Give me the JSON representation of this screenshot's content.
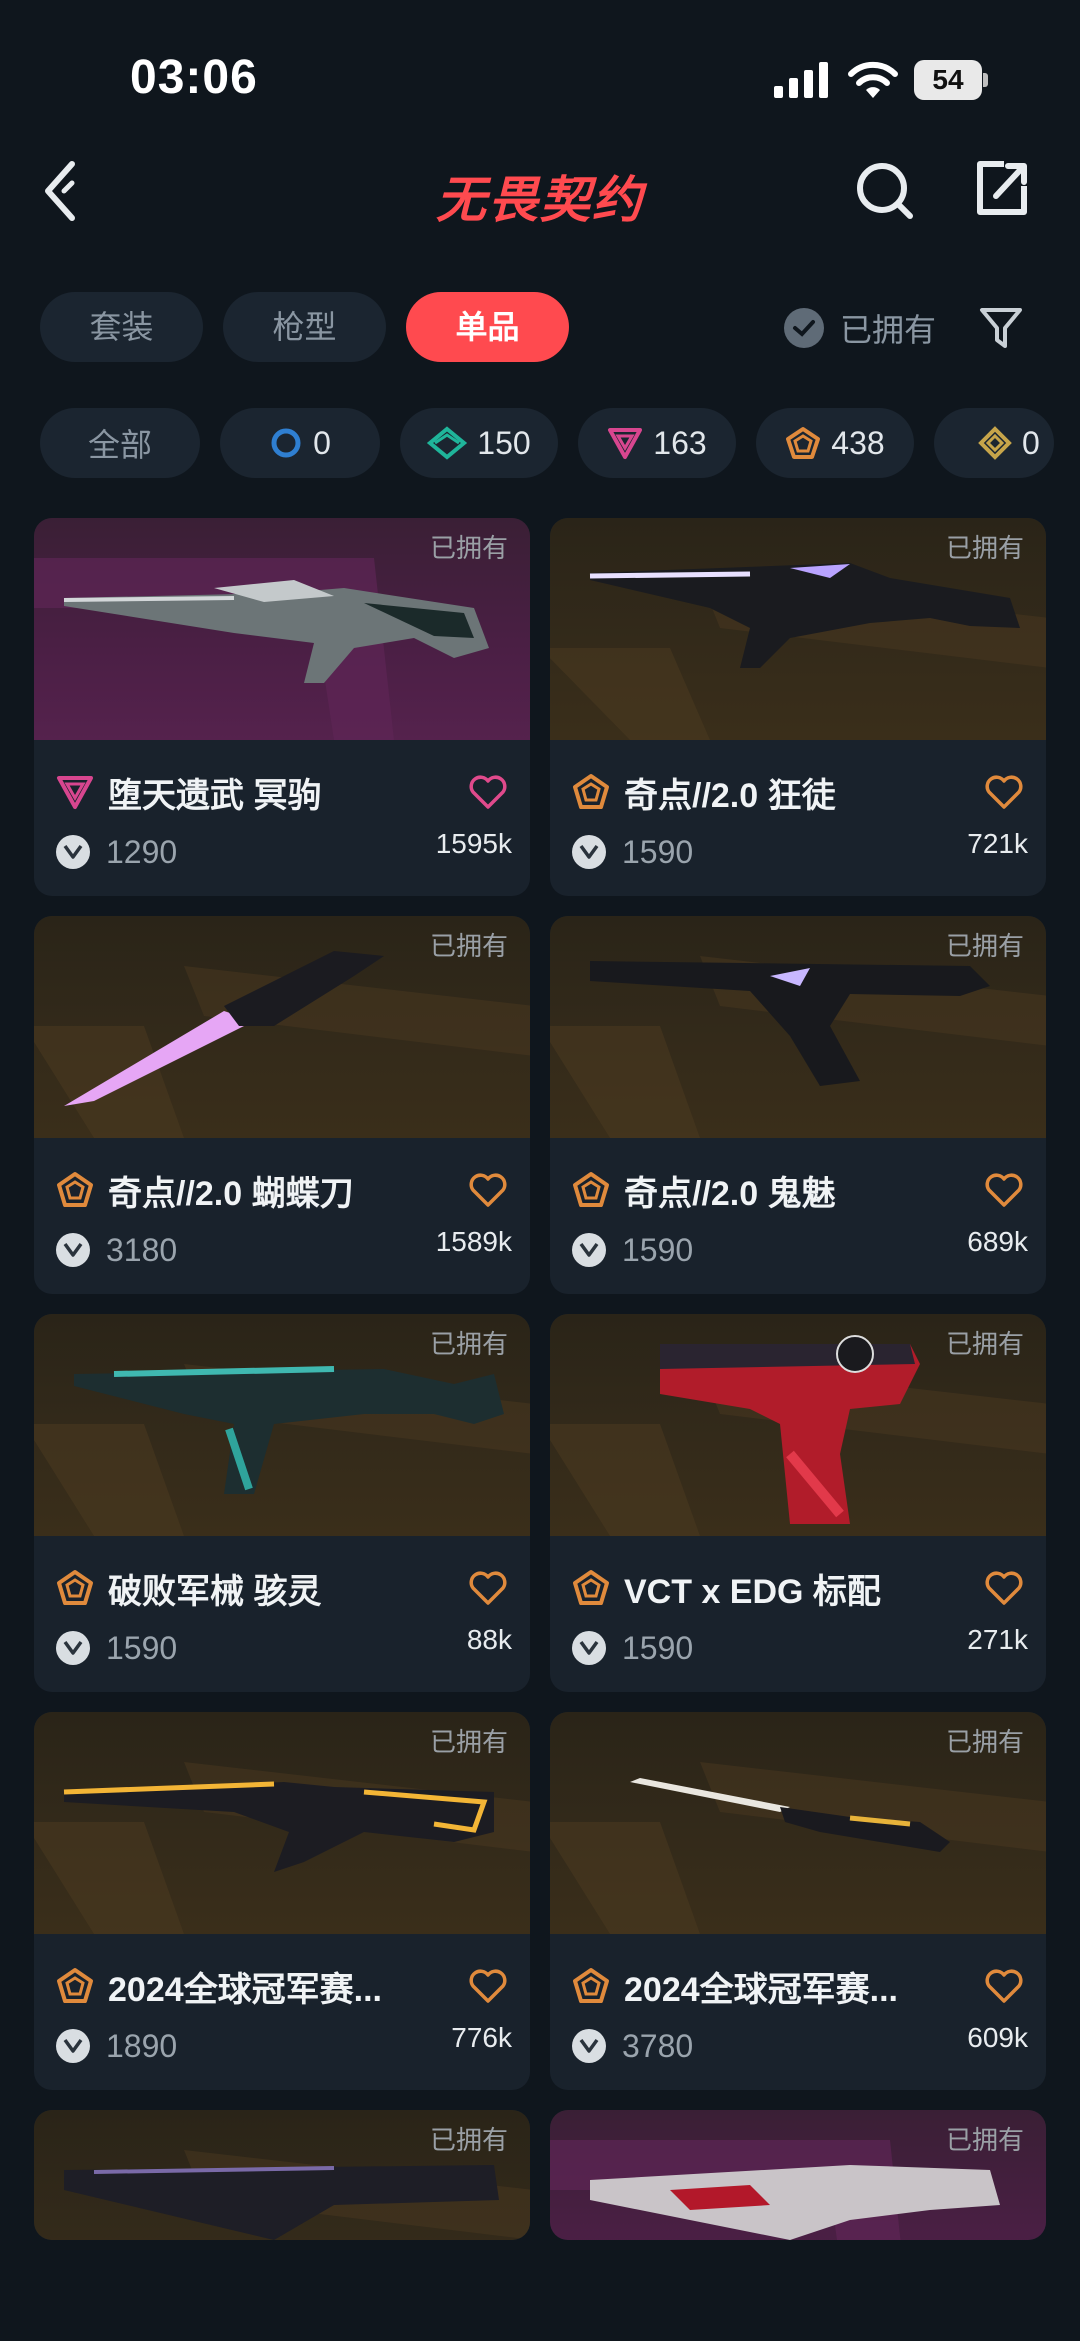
{
  "status": {
    "time": "03:06",
    "battery": "54"
  },
  "header": {
    "title": "无畏契约"
  },
  "tabs": [
    {
      "label": "套装",
      "active": false
    },
    {
      "label": "枪型",
      "active": false
    },
    {
      "label": "单品",
      "active": true
    }
  ],
  "owned_filter": {
    "label": "已拥有"
  },
  "chips": {
    "all": "全部",
    "items": [
      {
        "tier": "select",
        "count": "0",
        "color": "#2f7fd1"
      },
      {
        "tier": "deluxe",
        "count": "150",
        "color": "#1fb59a"
      },
      {
        "tier": "premium",
        "count": "163",
        "color": "#d8468f"
      },
      {
        "tier": "exclusive",
        "count": "438",
        "color": "#e08a3c"
      },
      {
        "tier": "ultra",
        "count": "0",
        "color": "#c7a54a"
      }
    ]
  },
  "colors": {
    "accent": "#ff4a4f",
    "exclusive": "#e08a3c",
    "premium": "#d8468f"
  },
  "cards": [
    {
      "name": "堕天遗武 冥驹",
      "tier": "premium",
      "price": "1290",
      "likes": "1595k",
      "owned": "已拥有",
      "bg": "purple"
    },
    {
      "name": "奇点//2.0 狂徒",
      "tier": "exclusive",
      "price": "1590",
      "likes": "721k",
      "owned": "已拥有",
      "bg": "gold"
    },
    {
      "name": "奇点//2.0 蝴蝶刀",
      "tier": "exclusive",
      "price": "3180",
      "likes": "1589k",
      "owned": "已拥有",
      "bg": "gold"
    },
    {
      "name": "奇点//2.0 鬼魅",
      "tier": "exclusive",
      "price": "1590",
      "likes": "689k",
      "owned": "已拥有",
      "bg": "gold"
    },
    {
      "name": "破败军械 骇灵",
      "tier": "exclusive",
      "price": "1590",
      "likes": "88k",
      "owned": "已拥有",
      "bg": "gold"
    },
    {
      "name": "VCT x EDG 标配",
      "tier": "exclusive",
      "price": "1590",
      "likes": "271k",
      "owned": "已拥有",
      "bg": "gold"
    },
    {
      "name": "2024全球冠军赛...",
      "tier": "exclusive",
      "price": "1890",
      "likes": "776k",
      "owned": "已拥有",
      "bg": "gold"
    },
    {
      "name": "2024全球冠军赛...",
      "tier": "exclusive",
      "price": "3780",
      "likes": "609k",
      "owned": "已拥有",
      "bg": "gold"
    },
    {
      "name": "",
      "tier": "exclusive",
      "price": "",
      "likes": "",
      "owned": "已拥有",
      "bg": "gold"
    },
    {
      "name": "",
      "tier": "premium",
      "price": "",
      "likes": "",
      "owned": "已拥有",
      "bg": "purple"
    }
  ]
}
